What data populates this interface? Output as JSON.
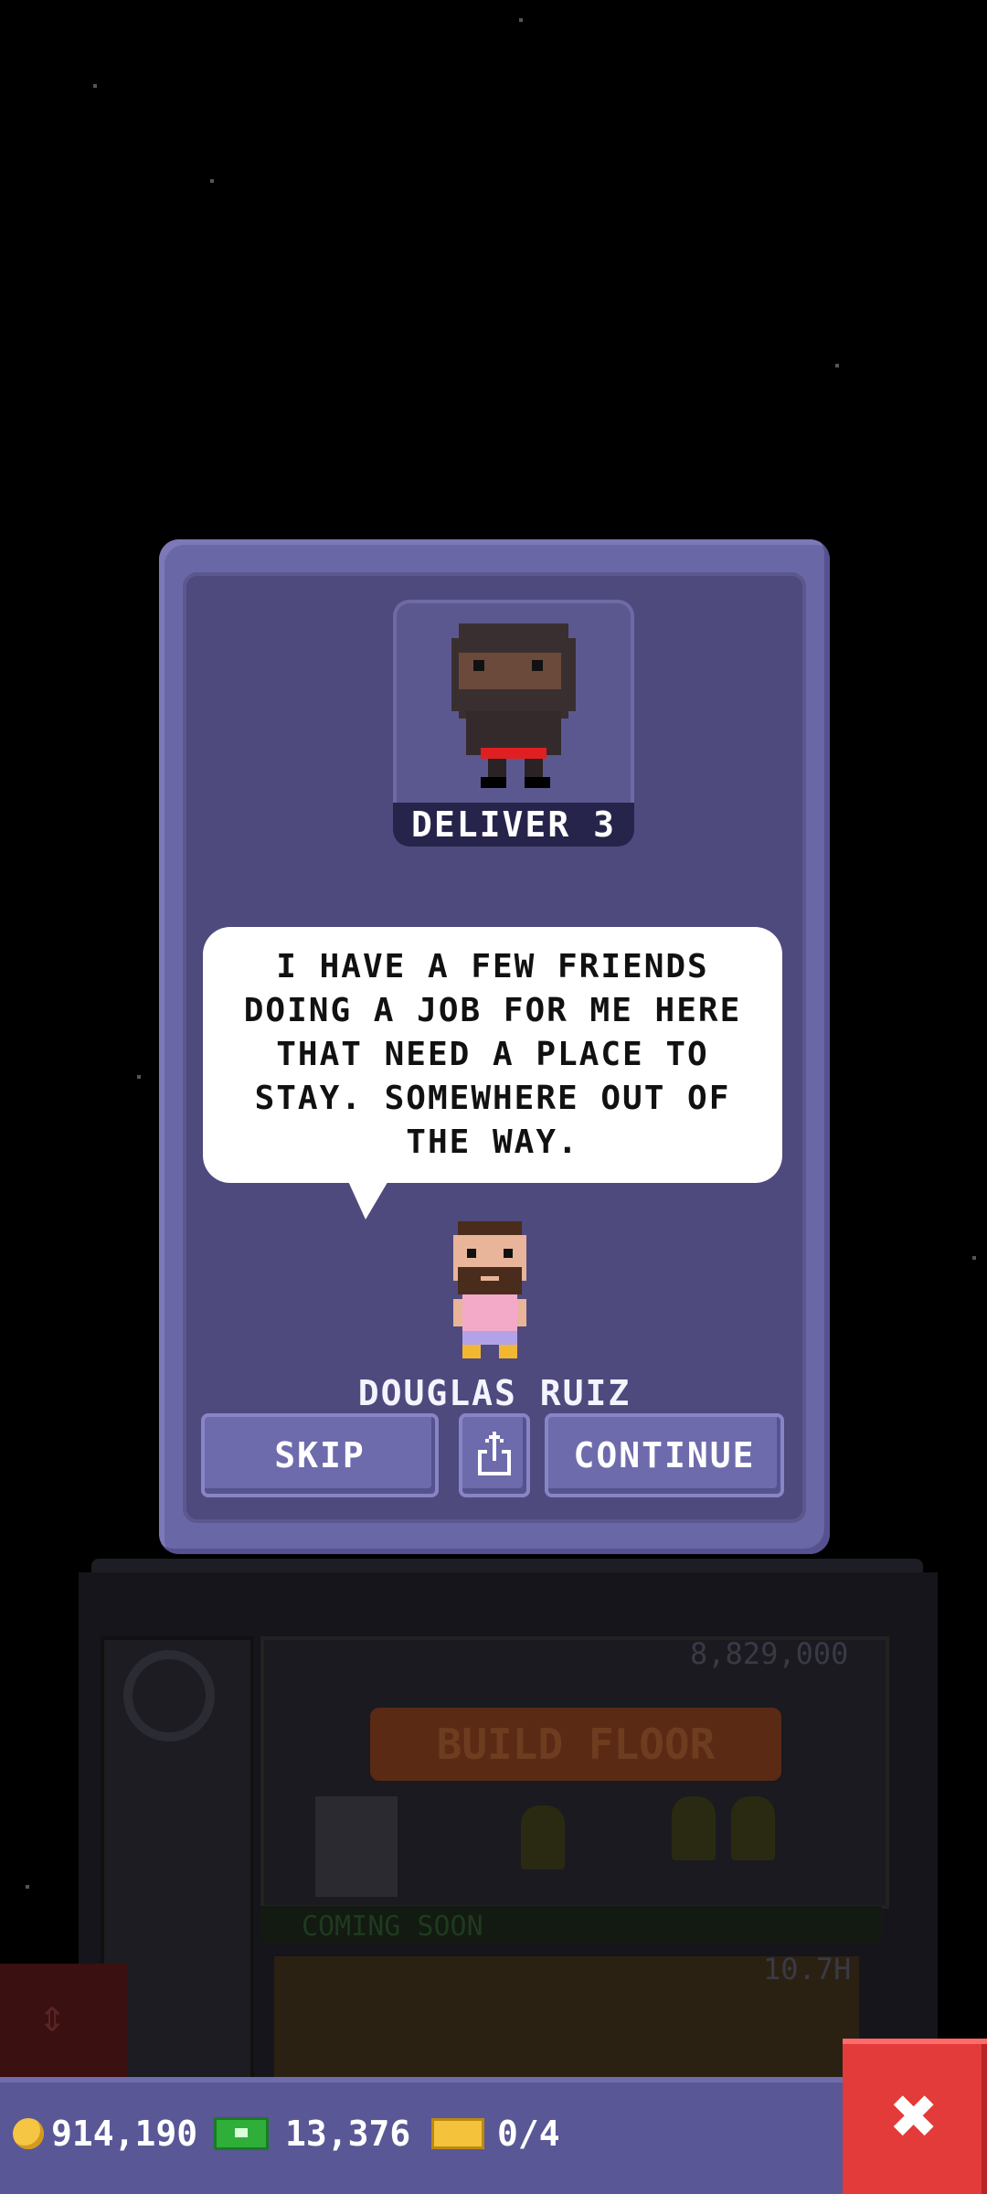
{
  "background": {
    "floor_price": "8,829,000",
    "build_label": "BUILD FLOOR",
    "coming_soon": "COMING SOON",
    "timer": "10.7H"
  },
  "mission": {
    "portrait_label": "DELIVER 3",
    "message": "I HAVE A FEW FRIENDS DOING A JOB FOR ME HERE THAT NEED A PLACE TO STAY. SOMEWHERE OUT OF THE WAY.",
    "speaker": "DOUGLAS RUIZ"
  },
  "buttons": {
    "skip": "SKIP",
    "continue": "CONTINUE"
  },
  "hud": {
    "coins": "914,190",
    "bux": "13,376",
    "tickets": "0/4"
  },
  "colors": {
    "dialog": "#6a67a7",
    "dialog_inner": "#4e4a7d",
    "close": "#e33a3a"
  }
}
